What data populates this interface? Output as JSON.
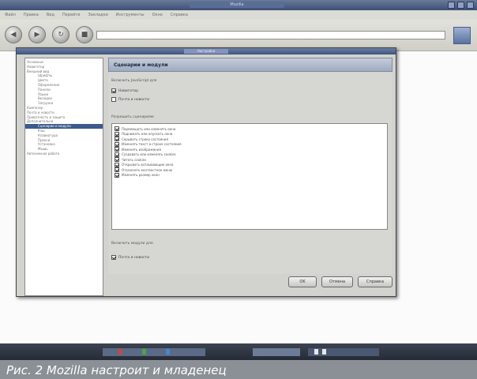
{
  "browser": {
    "window_title": "Mozilla",
    "menu": [
      "Файл",
      "Правка",
      "Вид",
      "Перейти",
      "Закладки",
      "Инструменты",
      "Окно",
      "Справка"
    ],
    "nav_icons": [
      "back-icon",
      "forward-icon",
      "reload-icon",
      "stop-icon"
    ]
  },
  "dialog": {
    "title": "Настройки",
    "tree": [
      {
        "label": "Основные",
        "level": 0
      },
      {
        "label": "Навигатор",
        "level": 0
      },
      {
        "label": "Внешний вид",
        "level": 0
      },
      {
        "label": "Шрифты",
        "level": 1
      },
      {
        "label": "Цвета",
        "level": 1
      },
      {
        "label": "Оформления",
        "level": 1
      },
      {
        "label": "Панели",
        "level": 1
      },
      {
        "label": "Языки",
        "level": 1
      },
      {
        "label": "Вкладки",
        "level": 1
      },
      {
        "label": "Загрузки",
        "level": 1
      },
      {
        "label": "Композер",
        "level": 0
      },
      {
        "label": "Почта и новости",
        "level": 0
      },
      {
        "label": "Приватность и защита",
        "level": 0
      },
      {
        "label": "Дополнительно",
        "level": 0
      },
      {
        "label": "Сценарии и модули",
        "level": 1,
        "selected": true
      },
      {
        "label": "Кэш",
        "level": 1
      },
      {
        "label": "Клавиатура",
        "level": 1
      },
      {
        "label": "Прокси",
        "level": 1
      },
      {
        "label": "Установка",
        "level": 1
      },
      {
        "label": "Мышь",
        "level": 1
      },
      {
        "label": "Автономная работа",
        "level": 0
      }
    ],
    "panel_title": "Сценарии и модули",
    "section1_label": "Включить JavaScript для",
    "section1_options": [
      {
        "label": "Навигатор",
        "checked": true
      },
      {
        "label": "Почта и новости",
        "checked": false
      }
    ],
    "section2_label": "Разрешить сценариям:",
    "permissions": [
      {
        "label": "Перемещать или изменять окна",
        "checked": true
      },
      {
        "label": "Поднимать или опускать окна",
        "checked": true
      },
      {
        "label": "Скрывать строку состояния",
        "checked": true
      },
      {
        "label": "Изменять текст в строке состояния",
        "checked": true
      },
      {
        "label": "Изменять изображения",
        "checked": true
      },
      {
        "label": "Создавать или изменять cookies",
        "checked": true
      },
      {
        "label": "Читать cookies",
        "checked": true
      },
      {
        "label": "Открывать всплывающие окна",
        "checked": true
      },
      {
        "label": "Отключать контекстное меню",
        "checked": true
      },
      {
        "label": "Изменять размер окон",
        "checked": true
      }
    ],
    "section3_label": "Включить модули для",
    "section3_options": [
      {
        "label": "Почта и новости",
        "checked": true
      }
    ],
    "buttons": {
      "ok": "OK",
      "cancel": "Отмена",
      "help": "Справка"
    }
  },
  "taskbar": {
    "accent": "#3c4352"
  },
  "caption": "Рис. 2 Mozilla настроит и младенец"
}
